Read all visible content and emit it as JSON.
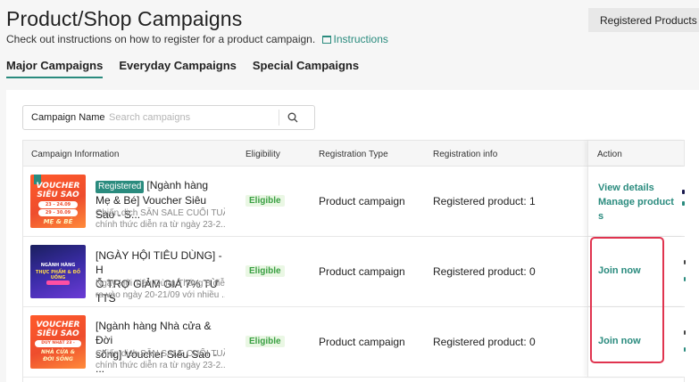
{
  "header": {
    "title": "Product/Shop Campaigns",
    "subtitle": "Check out instructions on how to register for a product campaign.",
    "instructions_link": "Instructions",
    "registered_products_button": "Registered Products"
  },
  "tabs": [
    {
      "label": "Major Campaigns",
      "active": true
    },
    {
      "label": "Everyday Campaigns",
      "active": false
    },
    {
      "label": "Special Campaigns",
      "active": false
    }
  ],
  "search": {
    "label": "Campaign Name",
    "placeholder": "Search campaigns",
    "icon": "search-icon"
  },
  "table": {
    "columns": [
      "Campaign Information",
      "Eligibility",
      "Registration Type",
      "Registration info",
      "Action"
    ],
    "rows": [
      {
        "thumb": {
          "style": "orange",
          "line1": "VOUCHER",
          "line2": "SIÊU SAO",
          "pill": "23 - 24.09",
          "pill2": "29 - 30.09",
          "line3": "MẸ & BÉ"
        },
        "badge": "Registered",
        "title": "[Ngành hàng Mẹ & Bé] Voucher Siêu Sao - S...",
        "desc_line1": "Chiến dịch SĂN SALE CUỐI TUẦN",
        "desc_line2": "chính thức diễn ra từ ngày 23-2...",
        "eligibility": "Eligible",
        "registration_type": "Product campaign",
        "registration_info": "Registered product: 1",
        "actions": [
          "View details",
          "Manage product",
          "s"
        ]
      },
      {
        "thumb": {
          "style": "blue",
          "line1": "NGÀNH HÀNG",
          "line2": "THỰC PHẨM & ĐỒ UỐNG",
          "pill": "",
          "pill2": "",
          "line3": ""
        },
        "badge": "",
        "title": "[NGÀY HỘI TIÊU DÙNG] - HỖ TRỢ GIẢM GIÁ 7% TỪ TTS",
        "title_line1": "[NGÀY HỘI TIÊU DÙNG] - H",
        "title_line2": "Ỗ TRỢ GIẢM GIÁ 7% TỪ TTS",
        "desc_line1": "Ngày Hội Tiêu Dùng Tháng 8 diễn",
        "desc_line2": "ra vào ngày 20-21/09 với nhiều ...",
        "eligibility": "Eligible",
        "registration_type": "Product campaign",
        "registration_info": "Registered product: 0",
        "actions": [
          "Join now"
        ]
      },
      {
        "thumb": {
          "style": "orange",
          "line1": "VOUCHER",
          "line2": "SIÊU SAO",
          "pill": "DUY NHẤT 23 - 24.09",
          "pill2": "",
          "line3": "NHÀ CỬA & ĐỜI SỐNG"
        },
        "badge": "",
        "title": "[Ngành hàng Nhà cửa & Đời sống] Voucher Siêu Sao - ...",
        "title_line1": "[Ngành hàng Nhà cửa & Đời",
        "title_line2": "sống] Voucher Siêu Sao - ...",
        "desc_line1": "Chiến dịch SĂN SALE CUỐI TUẦN",
        "desc_line2": "chính thức diễn ra từ ngày 23-2...",
        "eligibility": "Eligible",
        "registration_type": "Product campaign",
        "registration_info": "Registered product: 0",
        "actions": [
          "Join now"
        ]
      }
    ]
  },
  "colors": {
    "accent": "#2a8b7e",
    "eligible_text": "#3aa043",
    "eligible_bg": "#eaf7e4",
    "highlight": "#e0344f"
  }
}
